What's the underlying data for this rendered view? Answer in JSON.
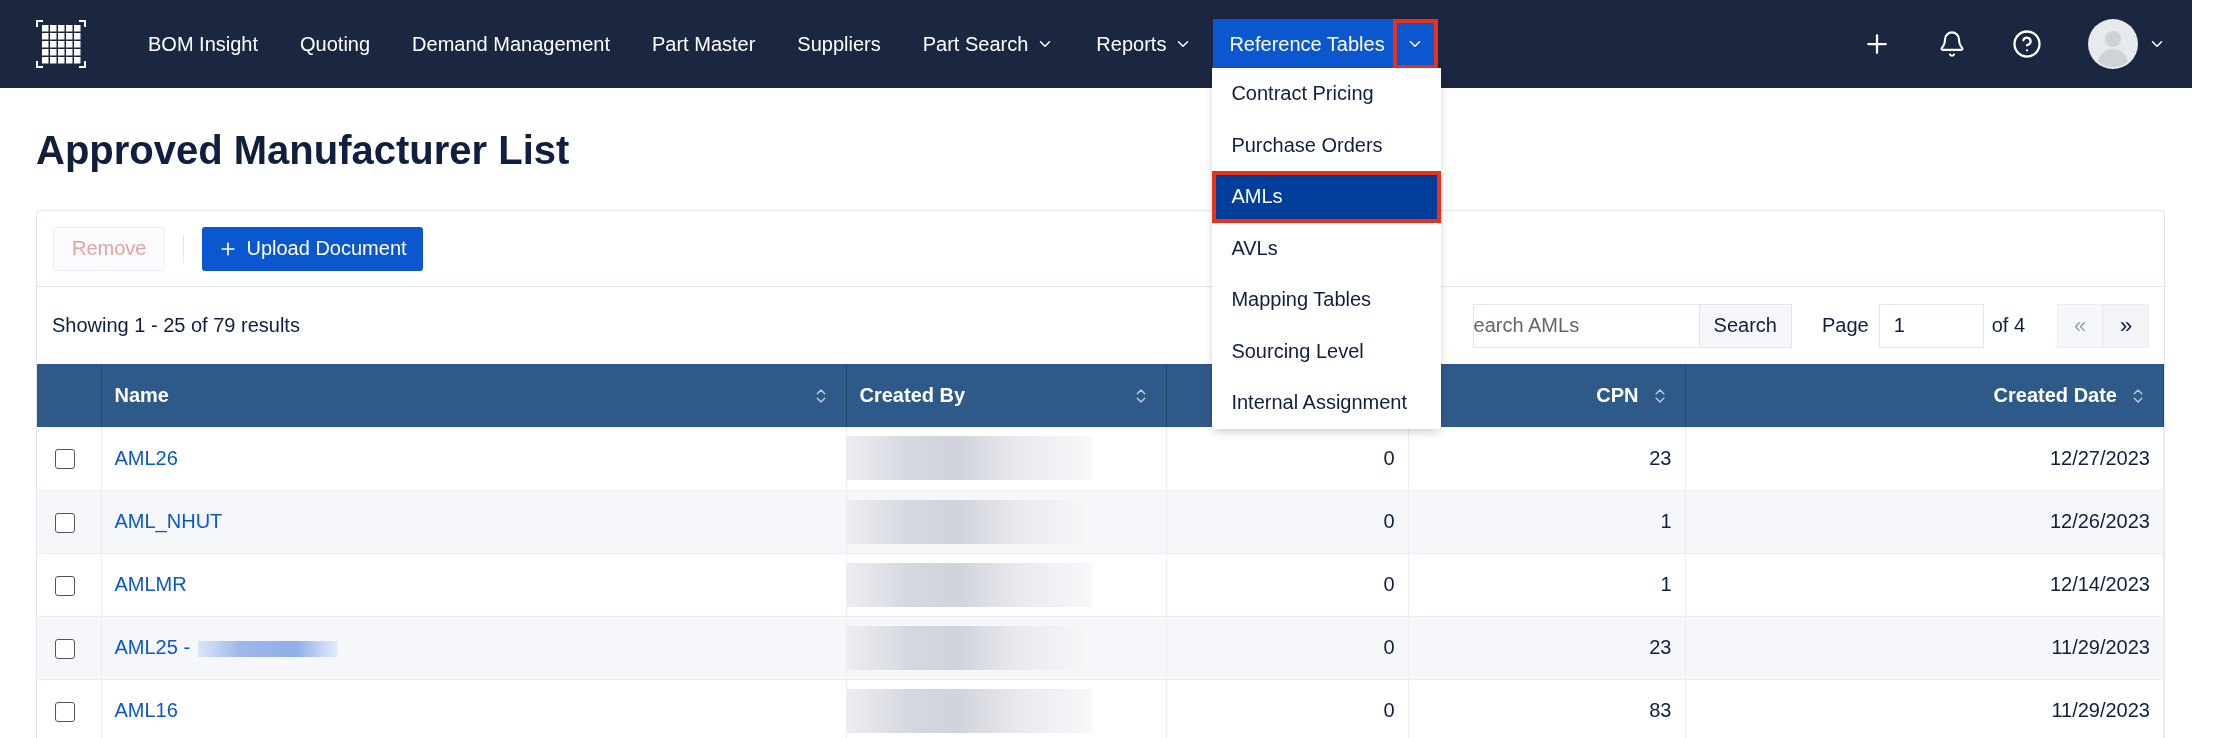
{
  "nav": {
    "items": [
      {
        "label": "BOM Insight",
        "kind": "link",
        "selected": false
      },
      {
        "label": "Quoting",
        "kind": "link",
        "selected": false
      },
      {
        "label": "Demand Management",
        "kind": "link",
        "selected": false
      },
      {
        "label": "Part Master",
        "kind": "link",
        "selected": false
      },
      {
        "label": "Suppliers",
        "kind": "link",
        "selected": false
      },
      {
        "label": "Part Search",
        "kind": "menu",
        "selected": false
      },
      {
        "label": "Reports",
        "kind": "menu",
        "selected": false
      },
      {
        "label": "Reference Tables",
        "kind": "split",
        "selected": true,
        "highlighted": true,
        "expanded": true
      }
    ]
  },
  "dropdown": {
    "items": [
      {
        "label": "Contract Pricing",
        "selected": false,
        "highlighted": false
      },
      {
        "label": "Purchase Orders",
        "selected": false,
        "highlighted": false
      },
      {
        "label": "AMLs",
        "selected": true,
        "highlighted": true
      },
      {
        "label": "AVLs",
        "selected": false,
        "highlighted": false
      },
      {
        "label": "Mapping Tables",
        "selected": false,
        "highlighted": false
      },
      {
        "label": "Sourcing Level",
        "selected": false,
        "highlighted": false
      },
      {
        "label": "Internal Assignment",
        "selected": false,
        "highlighted": false
      }
    ]
  },
  "page_title": "Approved Manufacturer List",
  "toolbar": {
    "remove": {
      "label": "Remove",
      "disabled": true
    },
    "upload": {
      "label": "Upload Document",
      "disabled": false
    }
  },
  "results": "Showing 1 - 25 of 79 results",
  "search": {
    "placeholder": "earch AMLs",
    "button": "Search"
  },
  "pagination": {
    "page_label": "Page",
    "page": "1",
    "of": "of 4",
    "prev": {
      "label": "«",
      "disabled": true
    },
    "next": {
      "label": "»",
      "disabled": false
    }
  },
  "table": {
    "columns": [
      {
        "label": "Name",
        "kind": "text"
      },
      {
        "label": "Created By",
        "kind": "text"
      },
      {
        "kind": "number"
      },
      {
        "label": "CPN",
        "kind": "number"
      },
      {
        "label": "Created Date",
        "kind": "number"
      }
    ],
    "rows": [
      {
        "checked": false,
        "name": "AML26",
        "created_by_redacted": true,
        "column_3": "0",
        "cpn": "23",
        "created_date": "12/27/2023"
      },
      {
        "checked": false,
        "name": "AML_NHUT",
        "created_by_redacted": true,
        "column_3": "0",
        "cpn": "1",
        "created_date": "12/26/2023"
      },
      {
        "checked": false,
        "name": "AMLMR",
        "created_by_redacted": true,
        "column_3": "0",
        "cpn": "1",
        "created_date": "12/14/2023"
      },
      {
        "checked": false,
        "name": "AML25 -",
        "name_redacted": true,
        "created_by_redacted": true,
        "column_3": "0",
        "cpn": "23",
        "created_date": "11/29/2023"
      },
      {
        "checked": false,
        "name": "AML16",
        "created_by_redacted": true,
        "column_3": "0",
        "cpn": "83",
        "created_date": "11/29/2023"
      }
    ]
  }
}
